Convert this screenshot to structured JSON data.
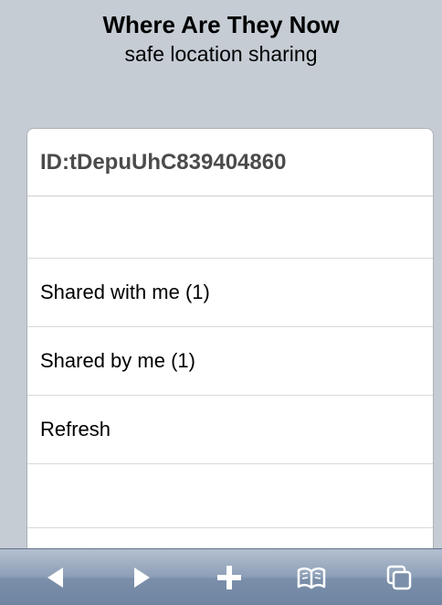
{
  "header": {
    "title": "Where Are They Now",
    "subtitle": "safe location sharing"
  },
  "list": {
    "id_label": "ID:tDepuUhC839404860",
    "items": [
      {
        "label": "Shared with me (1)"
      },
      {
        "label": "Shared by me (1)"
      },
      {
        "label": "Refresh"
      }
    ]
  },
  "toolbar": {
    "icons": [
      "back-arrow-icon",
      "forward-arrow-icon",
      "add-icon",
      "bookmarks-icon",
      "pages-icon"
    ],
    "icon_color": "#ffffff"
  }
}
